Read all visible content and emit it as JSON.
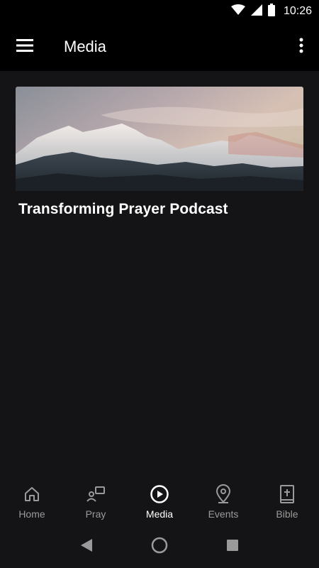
{
  "status_bar": {
    "time": "10:26",
    "icons": [
      "wifi-icon",
      "cell-signal-icon",
      "battery-icon"
    ]
  },
  "app_bar": {
    "title": "Media",
    "icons": [
      "menu-icon",
      "more-vert-icon"
    ]
  },
  "media": {
    "items": [
      {
        "title": "Transforming Prayer Podcast",
        "image": "mountain-landscape"
      }
    ]
  },
  "bottom_nav": {
    "items": [
      {
        "label": "Home",
        "icon": "home-icon",
        "active": false
      },
      {
        "label": "Pray",
        "icon": "pray-icon",
        "active": false
      },
      {
        "label": "Media",
        "icon": "play-circle-icon",
        "active": true
      },
      {
        "label": "Events",
        "icon": "location-pin-icon",
        "active": false
      },
      {
        "label": "Bible",
        "icon": "bible-icon",
        "active": false
      }
    ],
    "colors": {
      "active": "#ffffff",
      "inactive": "#9a9a9a"
    }
  },
  "system_nav": {
    "icons": [
      "back-icon",
      "home-circle-icon",
      "recents-icon"
    ]
  }
}
